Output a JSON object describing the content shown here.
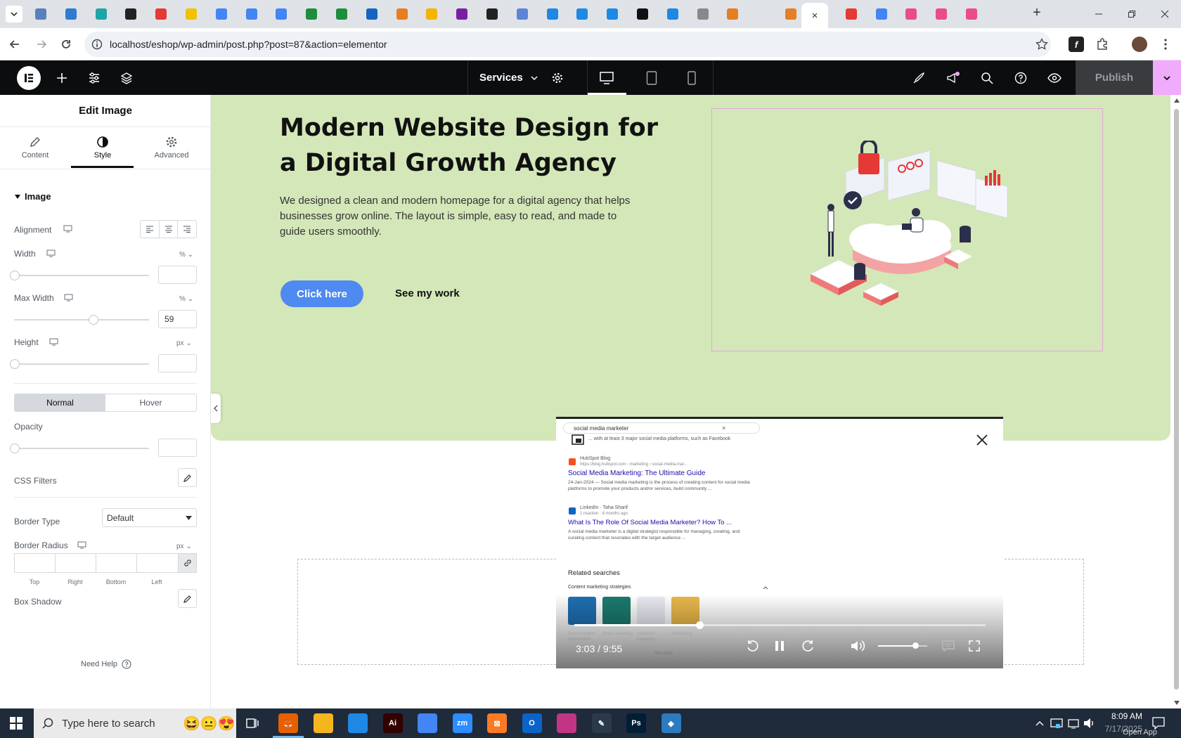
{
  "browser": {
    "url": "localhost/eshop/wp-admin/post.php?post=87&action=elementor",
    "tab_colors": [
      "#5b7fbd",
      "#2e7bcf",
      "#1fa5a5",
      "#222",
      "#e53935",
      "#f2c200",
      "#4285f4",
      "#4285f4",
      "#4285f4",
      "#1e8e3e",
      "#1e8e3e",
      "#1565c0",
      "#e67e22",
      "#f4b400",
      "#7b1fa2",
      "#222",
      "#5c85d6",
      "#1e88e5",
      "#1e88e5",
      "#1e88e5",
      "#111",
      "#1e88e5",
      "#888",
      "#e67e22",
      "#e67e22",
      "#ea4c89",
      "#e53935",
      "#4285f4",
      "#ea4c89",
      "#ea4c89",
      "#ea4c89"
    ],
    "active_tab_close": "×",
    "new_tab": "+"
  },
  "editor": {
    "page_name": "Services",
    "publish_label": "Publish"
  },
  "panel": {
    "title": "Edit Image",
    "tabs": [
      {
        "label": "Content",
        "icon": "pencil-icon"
      },
      {
        "label": "Style",
        "icon": "contrast-icon"
      },
      {
        "label": "Advanced",
        "icon": "gear-icon"
      }
    ],
    "section_title": "Image",
    "alignment_label": "Alignment",
    "width_label": "Width",
    "width_unit": "%",
    "width_value": "",
    "maxwidth_label": "Max Width",
    "maxwidth_unit": "%",
    "maxwidth_value": "59",
    "height_label": "Height",
    "height_unit": "px",
    "height_value": "",
    "normal_label": "Normal",
    "hover_label": "Hover",
    "opacity_label": "Opacity",
    "opacity_value": "",
    "css_filters_label": "CSS Filters",
    "border_type_label": "Border Type",
    "border_type_value": "Default",
    "border_radius_label": "Border Radius",
    "border_radius_unit": "px",
    "radius_sides": [
      "Top",
      "Right",
      "Bottom",
      "Left"
    ],
    "box_shadow_label": "Box Shadow",
    "need_help": "Need Help",
    "maxwidth_fraction": 0.59
  },
  "hero": {
    "title": "Modern Website Design for a Digital Growth Agency",
    "text": "We designed a clean and modern homepage for a digital agency that helps businesses grow online. The layout is simple, easy to read, and made to guide users smoothly.",
    "button_primary": "Click here",
    "button_secondary": "See my work",
    "bg_color": "#d3e7b8",
    "button_color": "#4f8af0"
  },
  "video": {
    "search_query": "social media marketer",
    "snippet_top": "... with at least 3 major social media platforms, such as Facebook",
    "result1_source": "HubSpot Blog",
    "result1_url": "https://blog.hubspot.com › marketing › social-media-mar...",
    "result1_title": "Social Media Marketing: The Ultimate Guide",
    "result1_snippet": "24-Jan-2024 — Social media marketing is the process of creating content for social media platforms to promote your products and/or services, build community ...",
    "result2_source": "LinkedIn · Taha Sharif",
    "result2_meta": "1 reaction · 8 months ago",
    "result2_title": "What Is The Role Of Social Media Marketer? How To ...",
    "result2_snippet": "A social media marketer is a digital strategist responsible for managing, creating, and curating content that resonates with the target audience ...",
    "related_title": "Related searches",
    "related_row": "Content marketing strategies",
    "thumbs": [
      {
        "label": "Search engine optimization",
        "color": "#1f6fb2"
      },
      {
        "label": "Email marketing",
        "color": "#1b7a6e"
      },
      {
        "label": "Influencer marketing",
        "color": "#e9e9f2"
      },
      {
        "label": "Advertising",
        "color": "#e8b84a"
      }
    ],
    "see_more": "See more",
    "time": "3:03 / 9:55",
    "progress": 0.305,
    "volume": 0.75
  },
  "taskbar": {
    "search_placeholder": "Type here to search",
    "apps": [
      {
        "name": "firefox",
        "color": "#e66000",
        "glyph": "🦊"
      },
      {
        "name": "file-explorer",
        "color": "#f3b61f",
        "glyph": ""
      },
      {
        "name": "vscode",
        "color": "#1e88e5",
        "glyph": ""
      },
      {
        "name": "illustrator",
        "color": "#330000",
        "glyph": "Ai"
      },
      {
        "name": "chrome",
        "color": "#4285f4",
        "glyph": ""
      },
      {
        "name": "zoom",
        "color": "#2d8cff",
        "glyph": "zm"
      },
      {
        "name": "xampp",
        "color": "#fb7a24",
        "glyph": "⊠"
      },
      {
        "name": "outlook",
        "color": "#0a64c8",
        "glyph": "O"
      },
      {
        "name": "photos",
        "color": "#c13584",
        "glyph": ""
      },
      {
        "name": "pen-tool",
        "color": "#2a3a4a",
        "glyph": "✎"
      },
      {
        "name": "photoshop",
        "color": "#001e36",
        "glyph": "Ps"
      },
      {
        "name": "app",
        "color": "#2b7bbf",
        "glyph": "◆"
      }
    ],
    "time": "8:09 AM",
    "date": "7/17/2025",
    "open_app": "Open App"
  }
}
